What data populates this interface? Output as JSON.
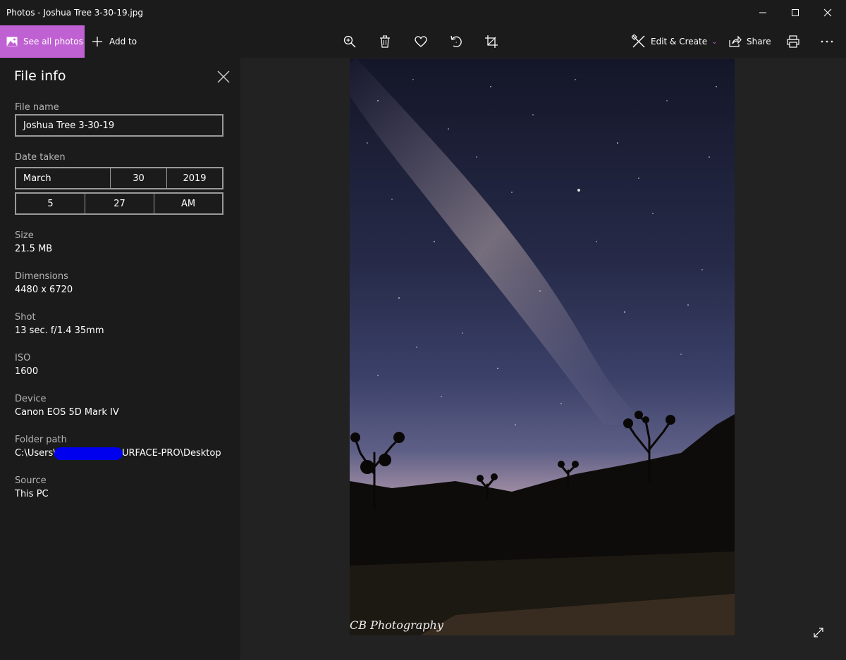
{
  "window": {
    "title": "Photos - Joshua Tree 3-30-19.jpg"
  },
  "toolbar": {
    "see_all_label": "See all photos",
    "add_to_label": "Add to",
    "edit_create_label": "Edit & Create",
    "share_label": "Share",
    "accent_color": "#c061d3",
    "icons": [
      "zoom-in-icon",
      "delete-icon",
      "favorite-heart-icon",
      "rotate-icon",
      "crop-icon",
      "edit-create-icon",
      "share-icon",
      "print-icon",
      "more-icon"
    ]
  },
  "file_info": {
    "title": "File info",
    "file_name_label": "File name",
    "file_name_value": "Joshua Tree 3-30-19",
    "date_taken_label": "Date taken",
    "month": "March",
    "day": "30",
    "year": "2019",
    "hour": "5",
    "minute": "27",
    "ampm": "AM",
    "size_label": "Size",
    "size_value": "21.5 MB",
    "dimensions_label": "Dimensions",
    "dimensions_value": "4480 x 6720",
    "shot_label": "Shot",
    "shot_value": "13 sec. f/1.4 35mm",
    "iso_label": "ISO",
    "iso_value": "1600",
    "device_label": "Device",
    "device_value": "Canon EOS 5D Mark IV",
    "folder_label": "Folder path",
    "folder_prefix": "C:\\Users\\",
    "folder_suffix": "URFACE-PRO\\Desktop",
    "source_label": "Source",
    "source_value": "This PC"
  },
  "viewer": {
    "watermark": "CB Photography"
  }
}
